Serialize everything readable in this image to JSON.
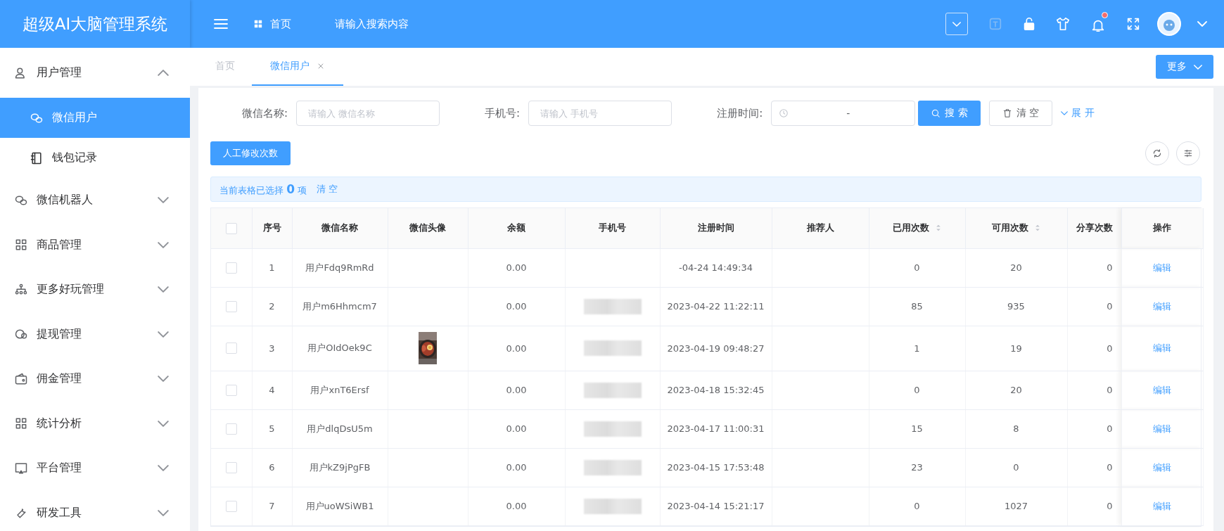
{
  "app_title": "超级AI大脑管理系统",
  "header": {
    "home_link": "首页",
    "search_placeholder": "请输入搜索内容",
    "has_unread": true
  },
  "sidebar": {
    "items": [
      {
        "label": "用户管理",
        "expanded": true,
        "children": [
          {
            "label": "微信用户",
            "selected": true
          },
          {
            "label": "钱包记录",
            "selected": false
          }
        ]
      },
      {
        "label": "微信机器人",
        "expanded": false
      },
      {
        "label": "商品管理",
        "expanded": false
      },
      {
        "label": "更多好玩管理",
        "expanded": false
      },
      {
        "label": "提现管理",
        "expanded": false
      },
      {
        "label": "佣金管理",
        "expanded": false
      },
      {
        "label": "统计分析",
        "expanded": false
      },
      {
        "label": "平台管理",
        "expanded": false
      },
      {
        "label": "研发工具",
        "expanded": false
      }
    ]
  },
  "tabs": [
    {
      "label": "首页",
      "selected": false,
      "closable": false
    },
    {
      "label": "微信用户",
      "selected": true,
      "closable": true
    }
  ],
  "more_button": "更多",
  "filters": [
    {
      "label": "微信名称:",
      "placeholder": "请输入 微信名称"
    },
    {
      "label": "手机号:",
      "placeholder": "请输入 手机号"
    }
  ],
  "date_filter": {
    "label": "注册时间:",
    "separator": "-"
  },
  "search_button": "搜 索",
  "clear_button": "清 空",
  "expand_link": "展 开",
  "action_button": "人工修改次数",
  "selection": {
    "text": "当前表格已选择 **0** 项",
    "clear": "清 空"
  },
  "table": {
    "all_checked": false,
    "columns": [
      {
        "title": "序号",
        "sortable": false
      },
      {
        "title": "微信名称",
        "sortable": false
      },
      {
        "title": "微信头像",
        "sortable": false
      },
      {
        "title": "余额",
        "sortable": false
      },
      {
        "title": "手机号",
        "sortable": false
      },
      {
        "title": "注册时间",
        "sortable": false
      },
      {
        "title": "推荐人",
        "sortable": false
      },
      {
        "title": "已用次数",
        "sortable": true
      },
      {
        "title": "可用次数",
        "sortable": true
      },
      {
        "title": "分享次数",
        "sortable": false
      },
      {
        "title": "操作",
        "sortable": false
      }
    ],
    "rows": [
      {
        "checked": false,
        "no": "1",
        "name": "用户Fdq9RmRd",
        "avatar": false,
        "balance": "0.00",
        "phone_blurred": false,
        "registered": "-04-24 14:49:34",
        "used": "0",
        "available": "20",
        "shared": "0",
        "action": "编辑"
      },
      {
        "checked": false,
        "no": "2",
        "name": "用户m6Hhmcm7",
        "avatar": false,
        "balance": "0.00",
        "phone_blurred": true,
        "registered": "2023-04-22 11:22:11",
        "used": "85",
        "available": "935",
        "shared": "0",
        "action": "编辑"
      },
      {
        "checked": false,
        "no": "3",
        "name": "用户OIdOek9C",
        "avatar": true,
        "balance": "0.00",
        "phone_blurred": true,
        "registered": "2023-04-19 09:48:27",
        "used": "1",
        "available": "19",
        "shared": "0",
        "action": "编辑"
      },
      {
        "checked": false,
        "no": "4",
        "name": "用户xnT6Ersf",
        "avatar": false,
        "balance": "0.00",
        "phone_blurred": true,
        "registered": "2023-04-18 15:32:45",
        "used": "0",
        "available": "20",
        "shared": "0",
        "action": "编辑"
      },
      {
        "checked": false,
        "no": "5",
        "name": "用户dlqDsU5m",
        "avatar": false,
        "balance": "0.00",
        "phone_blurred": true,
        "registered": "2023-04-17 11:00:31",
        "used": "15",
        "available": "8",
        "shared": "0",
        "action": "编辑"
      },
      {
        "checked": false,
        "no": "6",
        "name": "用户kZ9jPgFB",
        "avatar": false,
        "balance": "0.00",
        "phone_blurred": true,
        "registered": "2023-04-15 17:53:48",
        "used": "23",
        "available": "0",
        "shared": "0",
        "action": "编辑"
      },
      {
        "checked": false,
        "no": "7",
        "name": "用户uoWSiWB1",
        "avatar": false,
        "balance": "0.00",
        "phone_blurred": true,
        "registered": "2023-04-14 15:21:17",
        "used": "0",
        "available": "1027",
        "shared": "0",
        "action": "编辑"
      }
    ]
  }
}
